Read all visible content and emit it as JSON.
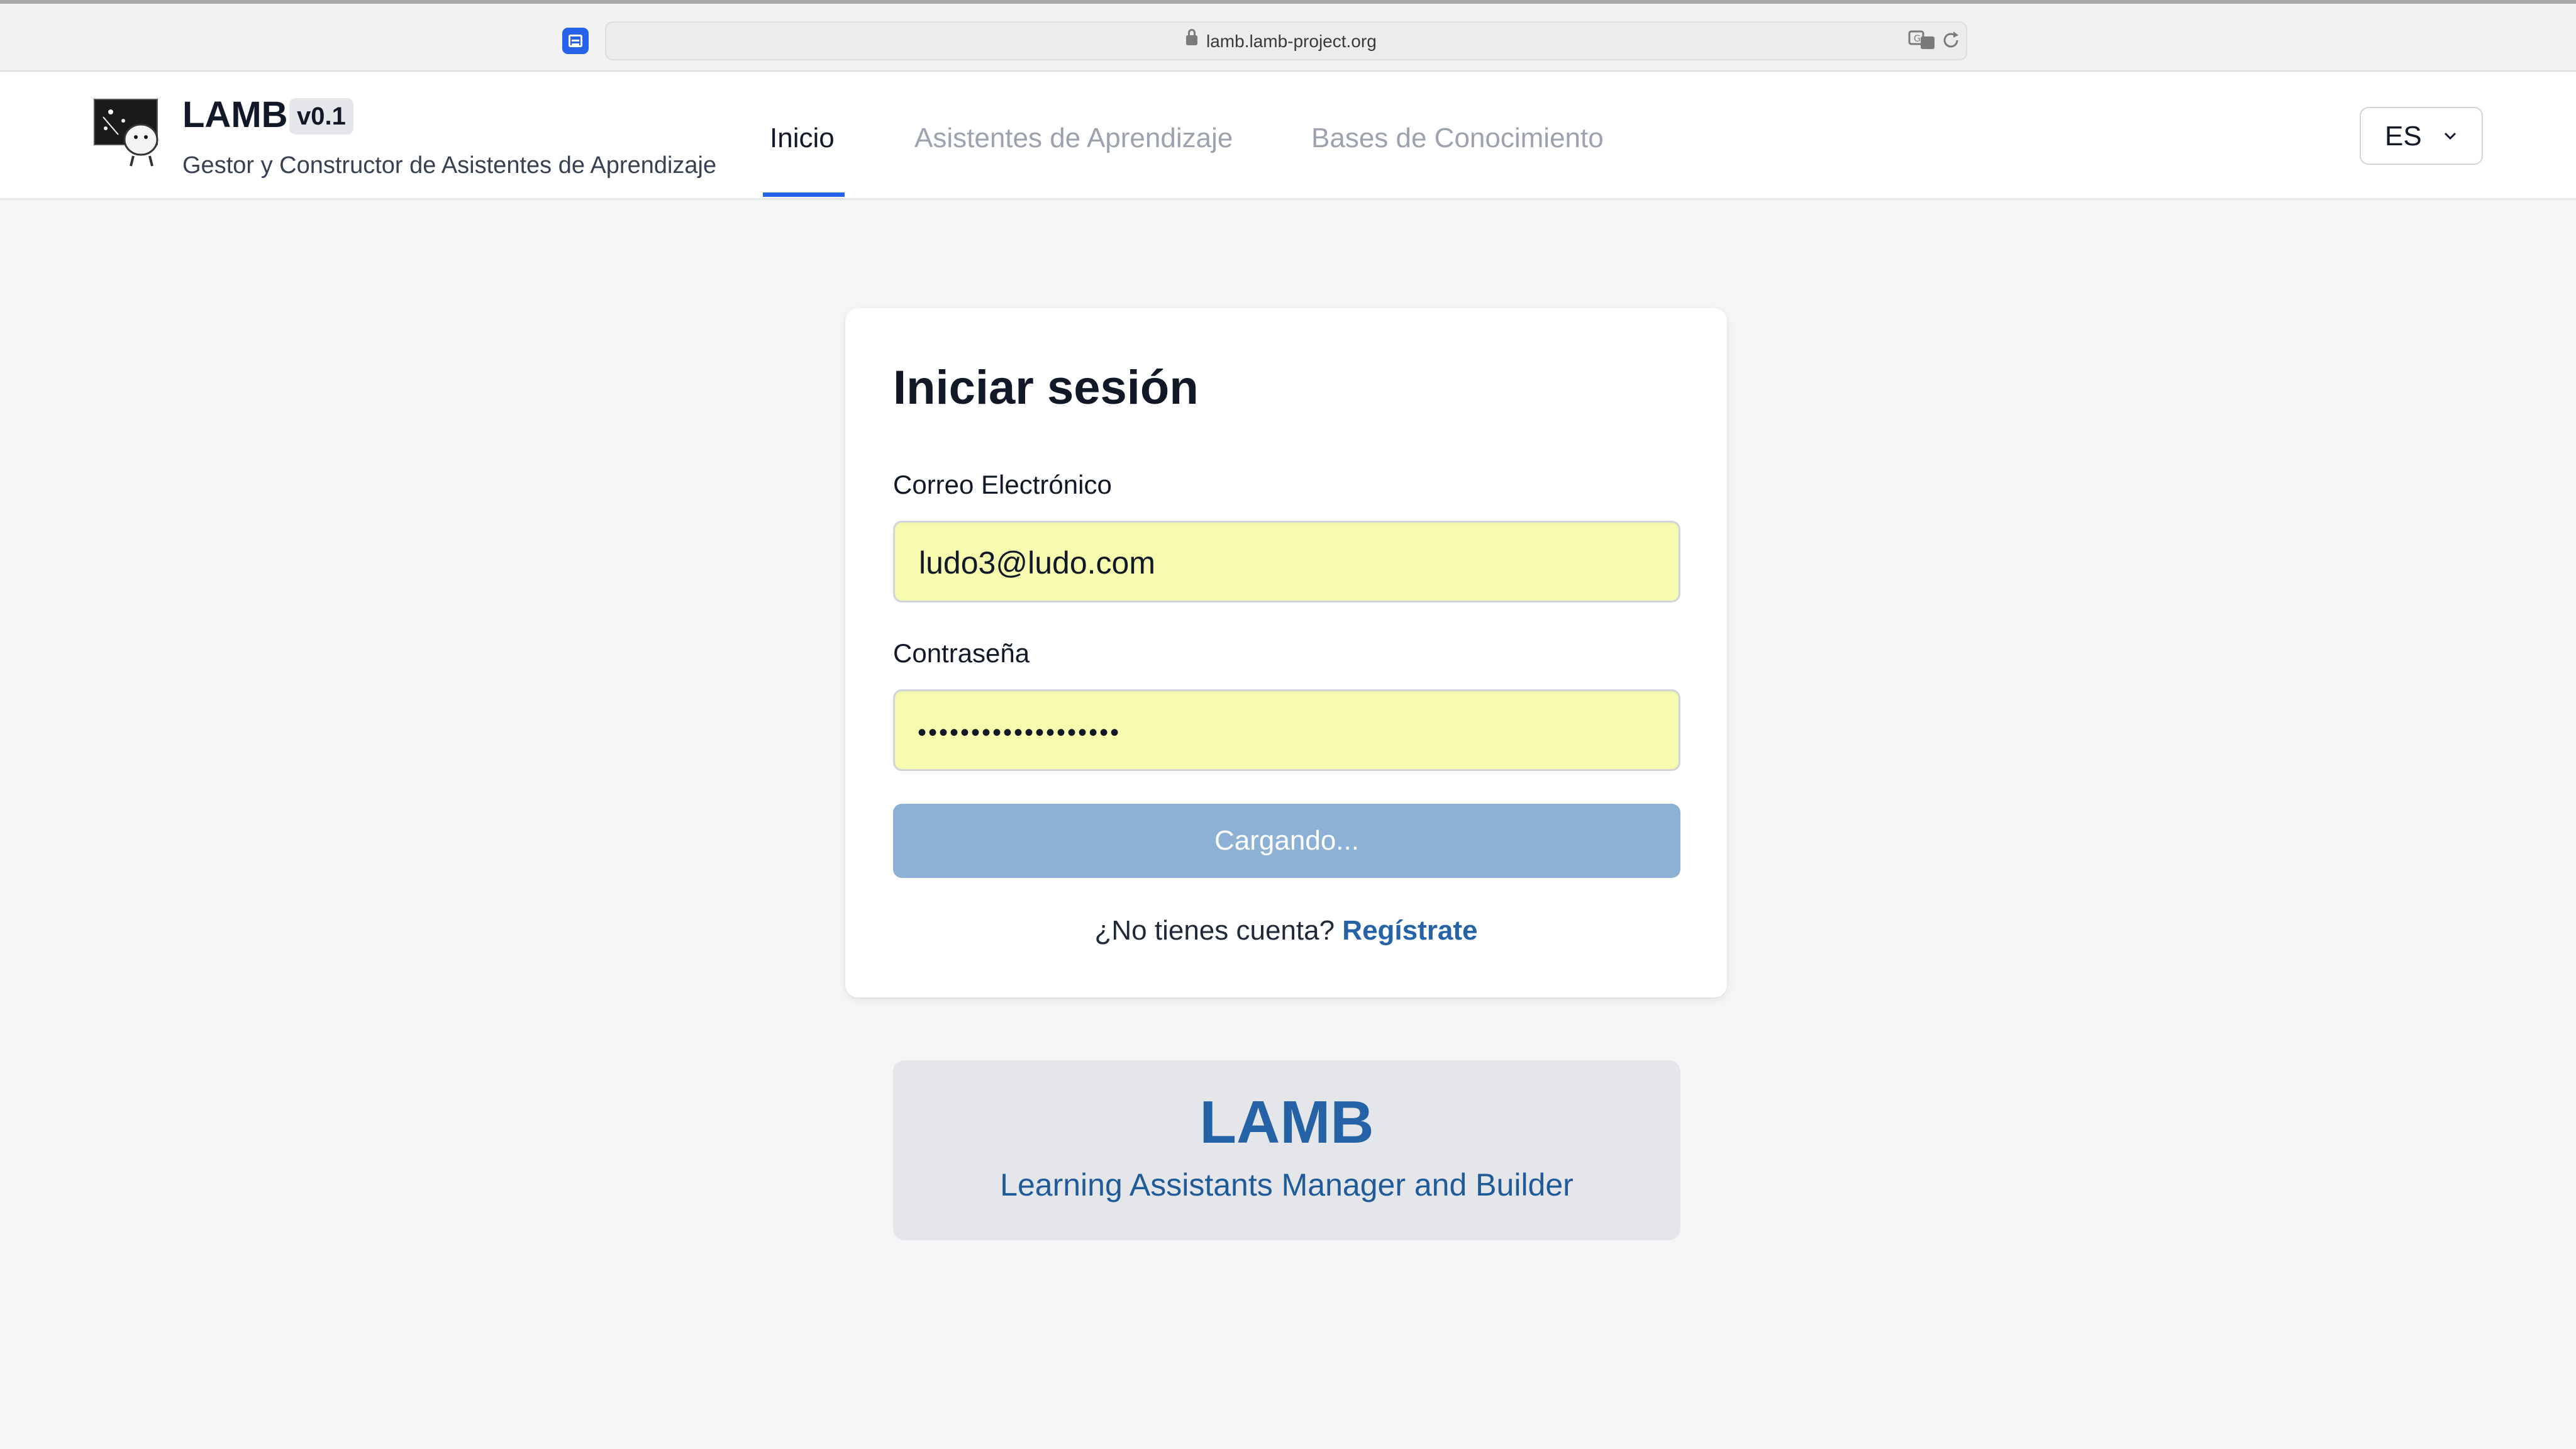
{
  "browser": {
    "url": "lamb.lamb-project.org"
  },
  "header": {
    "app_name": "LAMB",
    "version": "v0.1",
    "subtitle": "Gestor y Constructor de Asistentes de Aprendizaje",
    "tabs": [
      {
        "label": "Inicio",
        "active": true
      },
      {
        "label": "Asistentes de Aprendizaje",
        "active": false
      },
      {
        "label": "Bases de Conocimiento",
        "active": false
      }
    ],
    "language": "ES"
  },
  "login": {
    "title": "Iniciar sesión",
    "email_label": "Correo Electrónico",
    "email_value": "ludo3@ludo.com",
    "password_label": "Contraseña",
    "password_mask": "•••••••••••••••••••",
    "submit_label": "Cargando...",
    "signup_prompt": "¿No tienes cuenta?",
    "signup_link": "Regístrate"
  },
  "brand": {
    "title": "LAMB",
    "subtitle": "Learning Assistants Manager and Builder"
  },
  "colors": {
    "accent": "#2563eb",
    "link": "#2563a6",
    "input_autofill": "#f7fbb0",
    "button_loading": "#8cb1d4"
  }
}
